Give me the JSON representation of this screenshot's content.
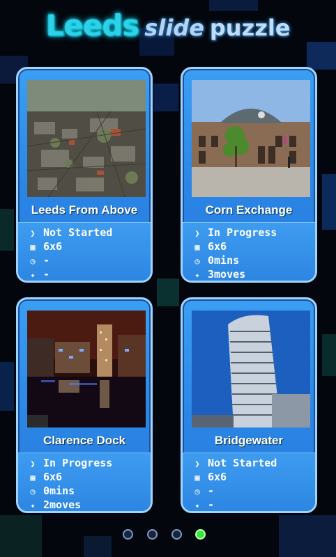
{
  "title": {
    "word1": "Leeds",
    "word2": "slide",
    "word3": "puzzle"
  },
  "puzzles": [
    {
      "name": "Leeds From Above",
      "status": "Not Started",
      "grid": "6x6",
      "time": "-",
      "moves": "-"
    },
    {
      "name": "Corn Exchange",
      "status": "In Progress",
      "grid": "6x6",
      "time": "0mins",
      "moves": "3moves"
    },
    {
      "name": "Clarence Dock",
      "status": "In Progress",
      "grid": "6x6",
      "time": "0mins",
      "moves": "2moves"
    },
    {
      "name": "Bridgewater",
      "status": "Not Started",
      "grid": "6x6",
      "time": "-",
      "moves": "-"
    }
  ],
  "icons": {
    "status": "chevron-right-icon",
    "grid": "grid-icon",
    "time": "clock-icon",
    "moves": "walking-person-icon"
  },
  "pagination": {
    "pages": 4,
    "active_page": 4
  },
  "colors": {
    "card_blue": "#2a86e6",
    "card_border": "#9fd4ff",
    "title_cyan": "#2fd0e8",
    "active_dot": "#39e63c"
  }
}
